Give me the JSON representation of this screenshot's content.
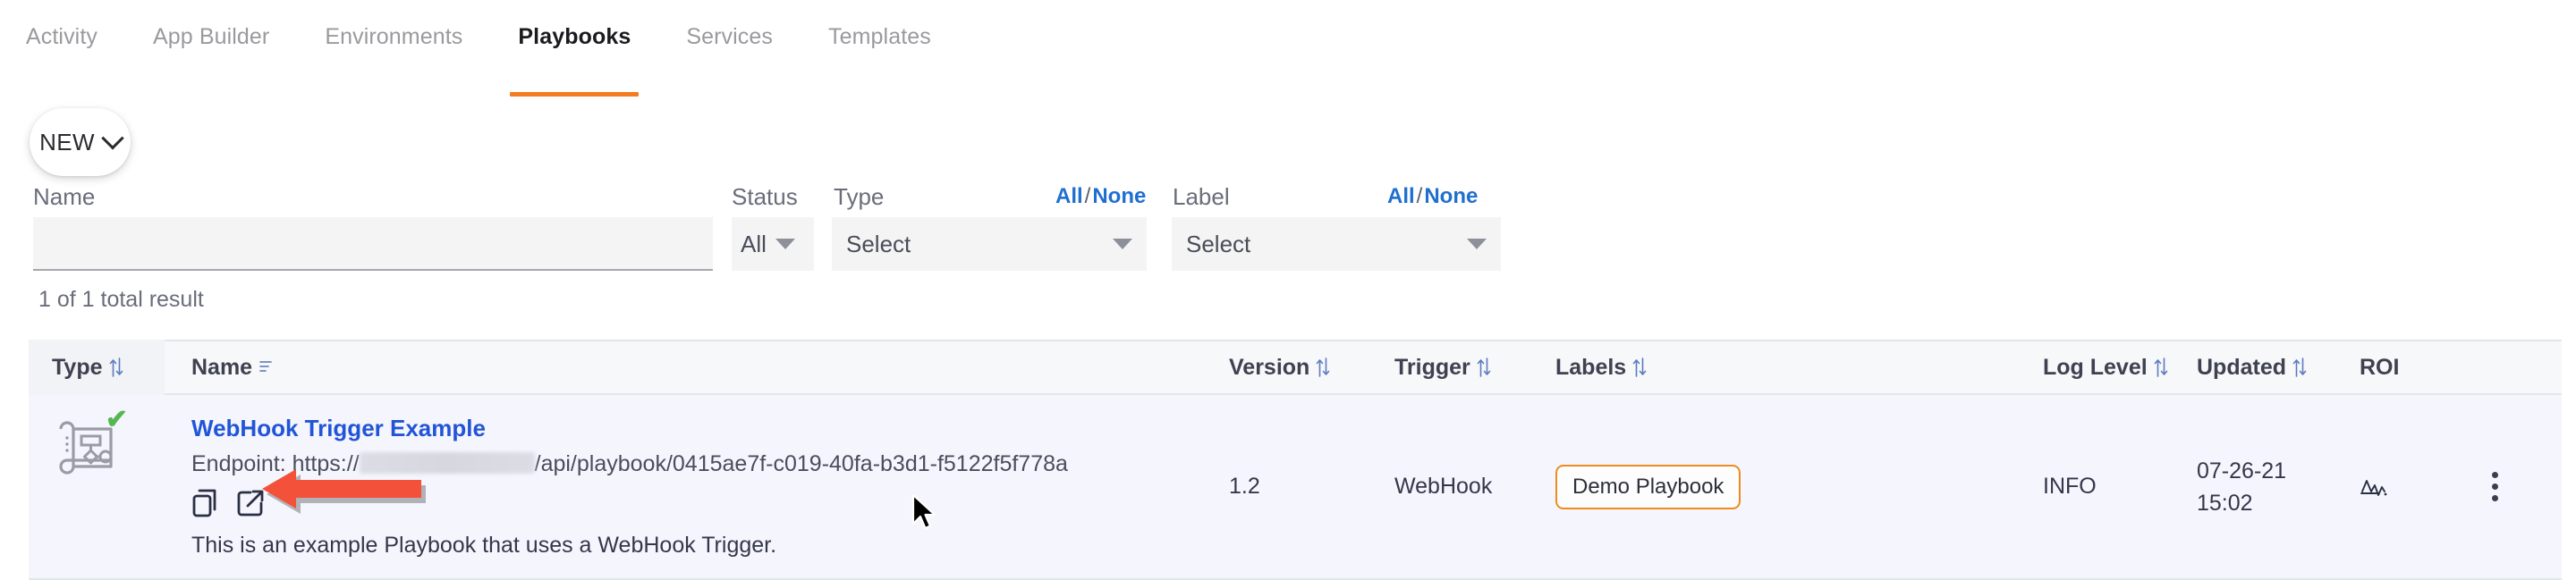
{
  "nav": {
    "tabs": [
      {
        "label": "Activity",
        "active": false
      },
      {
        "label": "App Builder",
        "active": false
      },
      {
        "label": "Environments",
        "active": false
      },
      {
        "label": "Playbooks",
        "active": true
      },
      {
        "label": "Services",
        "active": false
      },
      {
        "label": "Templates",
        "active": false
      }
    ],
    "active_accent": "#f47b20"
  },
  "toolbar": {
    "new_label": "NEW",
    "new_caret_icon": "chevron-down-icon"
  },
  "filters": {
    "name": {
      "label": "Name",
      "value": "",
      "placeholder": ""
    },
    "status": {
      "label": "Status",
      "value": "All"
    },
    "type": {
      "label": "Type",
      "value": "Select",
      "all_label": "All",
      "none_label": "None",
      "separator": "/"
    },
    "label": {
      "label": "Label",
      "value": "Select",
      "all_label": "All",
      "none_label": "None",
      "separator": "/"
    },
    "link_color": "#1f6fd0"
  },
  "results": {
    "count_text": "1 of 1 total result"
  },
  "table": {
    "columns": [
      {
        "key": "type",
        "label": "Type",
        "sortable": true,
        "sort_icon": "sort-updown-icon"
      },
      {
        "key": "name",
        "label": "Name",
        "sortable": true,
        "sort_icon": "sort-alpha-asc-icon"
      },
      {
        "key": "version",
        "label": "Version",
        "sortable": true,
        "sort_icon": "sort-updown-icon"
      },
      {
        "key": "trigger",
        "label": "Trigger",
        "sortable": true,
        "sort_icon": "sort-updown-icon"
      },
      {
        "key": "labels",
        "label": "Labels",
        "sortable": true,
        "sort_icon": "sort-updown-icon"
      },
      {
        "key": "log_level",
        "label": "Log Level",
        "sortable": true,
        "sort_icon": "sort-updown-icon"
      },
      {
        "key": "updated",
        "label": "Updated",
        "sortable": true,
        "sort_icon": "sort-updown-icon"
      },
      {
        "key": "roi",
        "label": "ROI",
        "sortable": false,
        "sort_icon": ""
      }
    ],
    "rows": [
      {
        "type_icon": "playbook-blueprint-icon",
        "status_icon": "green-check-icon",
        "name": "WebHook Trigger Example",
        "endpoint_prefix": "Endpoint: https://",
        "endpoint_host_redacted": true,
        "endpoint_path": "/api/playbook/0415ae7f-c019-40fa-b3d1-f5122f5f778a",
        "copy_icon": "copy-icon",
        "open_icon": "external-link-icon",
        "description": "This is an example Playbook that uses a WebHook Trigger.",
        "version": "1.2",
        "trigger": "WebHook",
        "labels": [
          "Demo Playbook"
        ],
        "log_level": "INFO",
        "updated_date": "07-26-21",
        "updated_time": "15:02",
        "roi_icon": "roi-chart-icon",
        "menu_icon": "kebab-menu-icon"
      }
    ]
  },
  "annotations": {
    "arrow_color": "#f4513a",
    "cursor_icon": "mouse-pointer"
  }
}
